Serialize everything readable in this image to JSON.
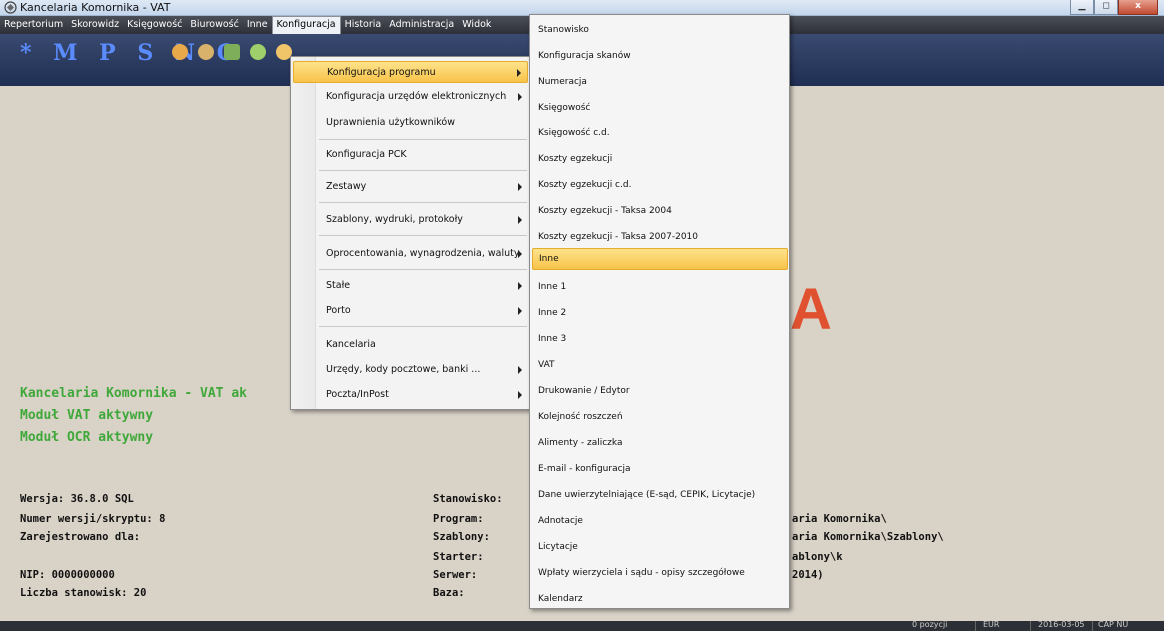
{
  "window": {
    "title": "Kancelaria Komornika - VAT",
    "controls": [
      "▁",
      "◻",
      "x"
    ]
  },
  "menubar": [
    {
      "label": "Repertorium",
      "active": false
    },
    {
      "label": "Skorowidz",
      "active": false
    },
    {
      "label": "Księgowość",
      "active": false
    },
    {
      "label": "Biurowość",
      "active": false
    },
    {
      "label": "Inne",
      "active": false
    },
    {
      "label": "Konfiguracja",
      "active": true
    },
    {
      "label": "Historia",
      "active": false
    },
    {
      "label": "Administracja",
      "active": false
    },
    {
      "label": "Widok",
      "active": false
    }
  ],
  "toolbar": {
    "letters": "* M P S N O"
  },
  "main": {
    "green_lines": [
      "Kancelaria Komornika - VAT ak",
      "Moduł VAT aktywny",
      "Moduł OCR aktywny"
    ],
    "info_left": [
      "Wersja: 36.8.0 SQL",
      "Numer wersji/skryptu: 8",
      "Zarejestrowano dla:",
      "",
      "  NIP: 0000000000",
      "Liczba stanowisk: 20"
    ],
    "info_mid": [
      "Stanowisko:",
      "Program:",
      "Szablony:",
      "Starter:",
      "Serwer:",
      "Baza:"
    ],
    "info_right": [
      "aria Komornika\\",
      "aria Komornika\\Szablony\\",
      "ablony\\k",
      " 2014)"
    ],
    "logo_fragment": "A"
  },
  "menu_konfiguracja": [
    {
      "label": "Konfiguracja programu",
      "submenu": true,
      "highlight": true
    },
    {
      "label": "Konfiguracja urzędów elektronicznych",
      "submenu": true
    },
    {
      "label": "Uprawnienia użytkowników",
      "submenu": false
    },
    {
      "label": "Konfiguracja PCK",
      "submenu": false
    },
    {
      "label": "Zestawy",
      "submenu": true
    },
    {
      "label": "Szablony, wydruki, protokoły",
      "submenu": true
    },
    {
      "label": "Oprocentowania, wynagrodzenia, waluty",
      "submenu": true
    },
    {
      "label": "Stałe",
      "submenu": true
    },
    {
      "label": "Porto",
      "submenu": true
    },
    {
      "label": "Kancelaria",
      "submenu": false
    },
    {
      "label": "Urzędy, kody pocztowe, banki ...",
      "submenu": true
    },
    {
      "label": "Poczta/InPost",
      "submenu": true
    }
  ],
  "menu_konfiguracja_programu": [
    {
      "label": "Stanowisko"
    },
    {
      "label": "Konfiguracja skanów"
    },
    {
      "label": "Numeracja"
    },
    {
      "label": "Księgowość"
    },
    {
      "label": "Księgowość c.d."
    },
    {
      "label": "Koszty egzekucji"
    },
    {
      "label": "Koszty egzekucji c.d."
    },
    {
      "label": "Koszty egzekucji - Taksa 2004"
    },
    {
      "label": "Koszty egzekucji - Taksa 2007-2010"
    },
    {
      "label": "Inne",
      "highlight": true
    },
    {
      "label": "Inne 1"
    },
    {
      "label": "Inne 2"
    },
    {
      "label": "Inne 3"
    },
    {
      "label": "VAT"
    },
    {
      "label": "Drukowanie / Edytor"
    },
    {
      "label": "Kolejność roszczeń"
    },
    {
      "label": "Alimenty - zaliczka"
    },
    {
      "label": "E-mail - konfiguracja"
    },
    {
      "label": "Dane uwierzytelniające (E-sąd, CEPIK, Licytacje)"
    },
    {
      "label": "Adnotacje"
    },
    {
      "label": "Licytacje"
    },
    {
      "label": "Wpłaty wierzyciela i sądu - opisy szczegółowe"
    },
    {
      "label": "Kalendarz"
    }
  ],
  "statusbar": {
    "records": "0 pozycji",
    "currency": "EUR",
    "date": "2016-03-05",
    "keys": "CAP NU"
  },
  "colors": {
    "menu_highlight": "#f8c34a",
    "green_text": "#3fa83a",
    "logo_red": "#e0522f",
    "menubar_bg": "#2d3038"
  }
}
